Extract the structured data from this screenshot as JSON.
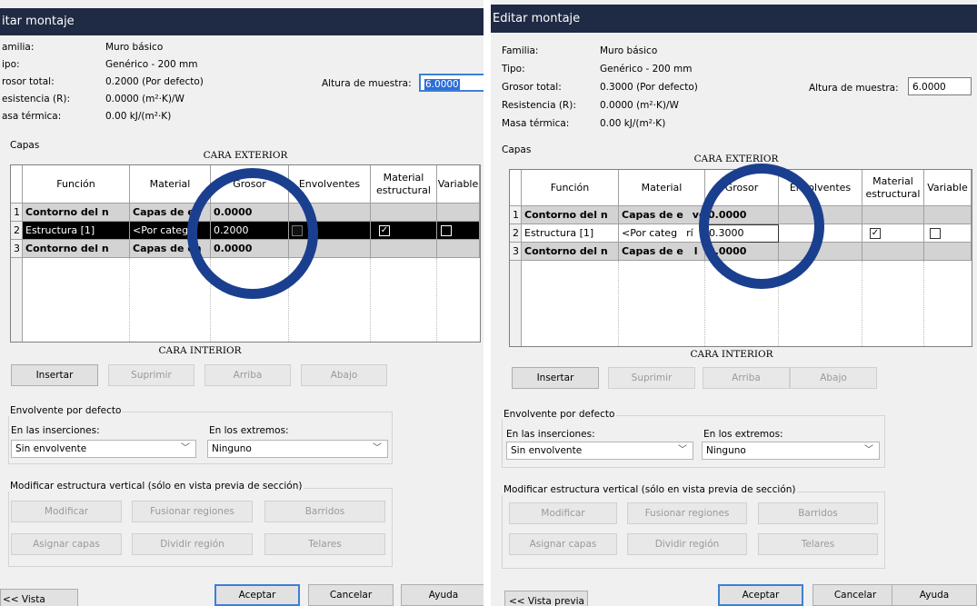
{
  "left": {
    "title": "itar montaje",
    "info_labels": [
      "amilia:",
      "ipo:",
      "rosor total:",
      "esistencia (R):",
      "asa térmica:"
    ],
    "info_values": [
      "Muro básico",
      "Genérico - 200 mm",
      "0.2000 (Por defecto)",
      "0.0000 (m²·K)/W",
      "0.00 kJ/(m²·K)"
    ],
    "altura_label": "Altura de muestra:",
    "altura_value": "6.0000",
    "capas_label": "Capas",
    "cara_exterior": "CARA EXTERIOR",
    "cara_interior": "CARA INTERIOR",
    "headers": [
      "Función",
      "Material",
      "Grosor",
      "Envolventes",
      "Material estructural",
      "Variable"
    ],
    "rows": [
      {
        "num": "1",
        "funcion": "Contorno del n",
        "material": "Capas de en",
        "material_tail": "ol",
        "grosor": "0.0000"
      },
      {
        "num": "2",
        "funcion": "Estructura [1]",
        "material": "<Por catego",
        "grosor": "0.2000"
      },
      {
        "num": "3",
        "funcion": "Contorno del n",
        "material": "Capas de en",
        "material_tail": "l",
        "grosor": "0.0000"
      }
    ],
    "buttons": [
      "Insertar",
      "Suprimir",
      "Arriba",
      "Abajo"
    ],
    "envolvente_title": "Envolvente por defecto",
    "inserciones_label": "En las inserciones:",
    "inserciones_value": "Sin envolvente",
    "extremos_label": "En los extremos:",
    "extremos_value": "Ninguno",
    "modificar_title": "Modificar estructura vertical (sólo en vista previa de sección)",
    "mod_buttons": [
      "Modificar",
      "Fusionar regiones",
      "Barridos",
      "Asignar capas",
      "Dividir región",
      "Telares"
    ],
    "vista_previa": "<< Vista previa",
    "aceptar": "Aceptar",
    "cancelar": "Cancelar",
    "ayuda": "Ayuda"
  },
  "right": {
    "title": "Editar montaje",
    "info_labels": [
      "Familia:",
      "Tipo:",
      "Grosor total:",
      "Resistencia (R):",
      "Masa térmica:"
    ],
    "info_values": [
      "Muro básico",
      "Genérico - 200 mm",
      "0.3000 (Por defecto)",
      "0.0000 (m²·K)/W",
      "0.00 kJ/(m²·K)"
    ],
    "altura_label": "Altura de muestra:",
    "altura_value": "6.0000",
    "capas_label": "Capas",
    "cara_exterior": "CARA EXTERIOR",
    "cara_interior": "CARA INTERIOR",
    "headers": [
      "Función",
      "Material",
      "Grosor",
      "Envolventes",
      "Material estructural",
      "Variable"
    ],
    "rows": [
      {
        "num": "1",
        "funcion": "Contorno del n",
        "material": "Capas de e",
        "material_tail": "vol",
        "grosor": "0.0000"
      },
      {
        "num": "2",
        "funcion": "Estructura [1]",
        "material": "<Por categ",
        "material_tail": "rí",
        "grosor": "0.3000"
      },
      {
        "num": "3",
        "funcion": "Contorno del n",
        "material": "Capas de e",
        "material_tail": "l",
        "grosor": "0.0000"
      }
    ],
    "buttons": [
      "Insertar",
      "Suprimir",
      "Arriba",
      "Abajo"
    ],
    "envolvente_title": "Envolvente por defecto",
    "inserciones_label": "En las inserciones:",
    "inserciones_value": "Sin envolvente",
    "extremos_label": "En los extremos:",
    "extremos_value": "Ninguno",
    "modificar_title": "Modificar estructura vertical (sólo en vista previa de sección)",
    "mod_buttons": [
      "Modificar",
      "Fusionar regiones",
      "Barridos",
      "Asignar capas",
      "Dividir región",
      "Telares"
    ],
    "vista_previa": "<< Vista previa",
    "aceptar": "Aceptar",
    "cancelar": "Cancelar",
    "ayuda": "Ayuda"
  },
  "colors": {
    "titlebar": "#1f2a44",
    "circle": "#1b3f8f",
    "selected_row": "#000000",
    "boundary_row": "#d3d3d3"
  }
}
